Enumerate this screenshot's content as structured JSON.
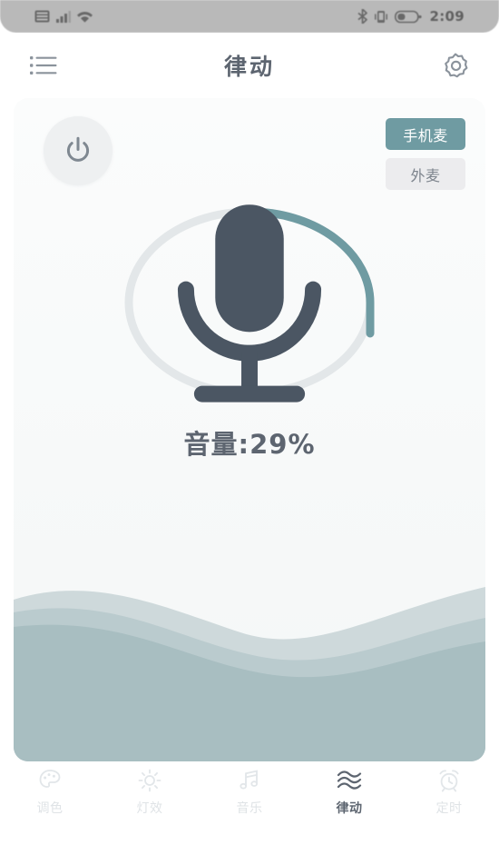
{
  "status_bar": {
    "time": "2:09",
    "left_icons": [
      "sim-card-icon",
      "signal-bars-icon",
      "wifi-icon"
    ],
    "right_icons": [
      "bluetooth-icon",
      "vibrate-icon",
      "battery-icon"
    ],
    "background": "#b9b9b9"
  },
  "header": {
    "title": "律动",
    "menu_icon": "list-menu-icon",
    "settings_icon": "gear-icon"
  },
  "main": {
    "power_icon": "power-icon",
    "mic_source": {
      "selected": "手机麦",
      "options": [
        {
          "label": "手机麦",
          "active": true
        },
        {
          "label": "外麦",
          "active": false
        }
      ]
    },
    "volume": {
      "label": "音量:29%",
      "percent": 29,
      "center_icon": "microphone-icon",
      "track_color": "#e3e7e9",
      "progress_color": "#6f9ba2"
    },
    "wave_colors": [
      "#ced9db",
      "#b3c5c8",
      "#a4b9bc"
    ]
  },
  "bottom_nav": {
    "items": [
      {
        "label": "调色",
        "icon": "palette-icon",
        "active": false
      },
      {
        "label": "灯效",
        "icon": "brightness-icon",
        "active": false
      },
      {
        "label": "音乐",
        "icon": "music-note-icon",
        "active": false
      },
      {
        "label": "律动",
        "icon": "wave-icon",
        "active": true
      },
      {
        "label": "定时",
        "icon": "alarm-clock-icon",
        "active": false
      }
    ],
    "active_color": "#5d6570",
    "inactive_color": "#dfe3e6"
  }
}
